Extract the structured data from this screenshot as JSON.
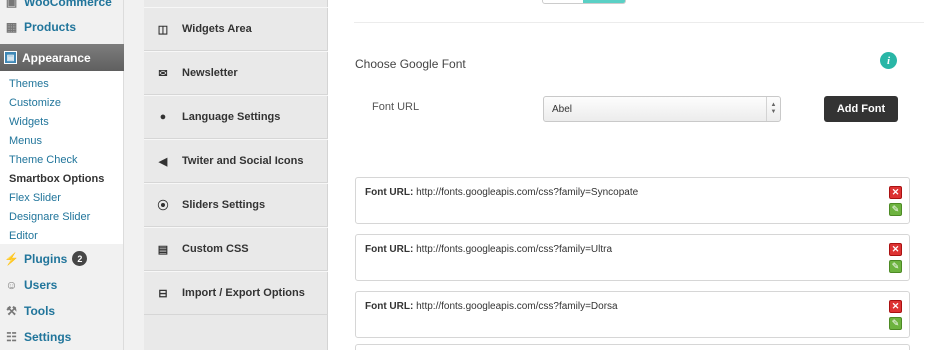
{
  "admin_menu": {
    "woocommerce": "WooCommerce",
    "products": "Products",
    "appearance": "Appearance",
    "submenu": [
      "Themes",
      "Customize",
      "Widgets",
      "Menus",
      "Theme Check",
      "Smartbox Options",
      "Flex Slider",
      "Designare Slider",
      "Editor"
    ],
    "plugins": "Plugins",
    "plugins_badge": "2",
    "users": "Users",
    "tools": "Tools",
    "settings": "Settings"
  },
  "options_nav": [
    {
      "label": "Widgets Area",
      "icon": "columns-icon"
    },
    {
      "label": "Newsletter",
      "icon": "envelope-icon"
    },
    {
      "label": "Language Settings",
      "icon": "globe-icon"
    },
    {
      "label": "Twiter and Social Icons",
      "icon": "megaphone-icon"
    },
    {
      "label": "Sliders Settings",
      "icon": "play-circle-icon"
    },
    {
      "label": "Custom CSS",
      "icon": "file-icon"
    },
    {
      "label": "Import / Export Options",
      "icon": "inbox-icon"
    }
  ],
  "google_font": {
    "section_title": "Choose Google Font",
    "field_label": "Font URL",
    "selected_font": "Abel",
    "add_button": "Add Font",
    "url_label": "Font URL:",
    "fonts": [
      "http://fonts.googleapis.com/css?family=Syncopate",
      "http://fonts.googleapis.com/css?family=Ultra",
      "http://fonts.googleapis.com/css?family=Dorsa"
    ]
  },
  "colors": {
    "accent": "#21759b",
    "toggle_on": "#5ad0c5",
    "delete": "#dd3333",
    "edit": "#6db33f"
  }
}
